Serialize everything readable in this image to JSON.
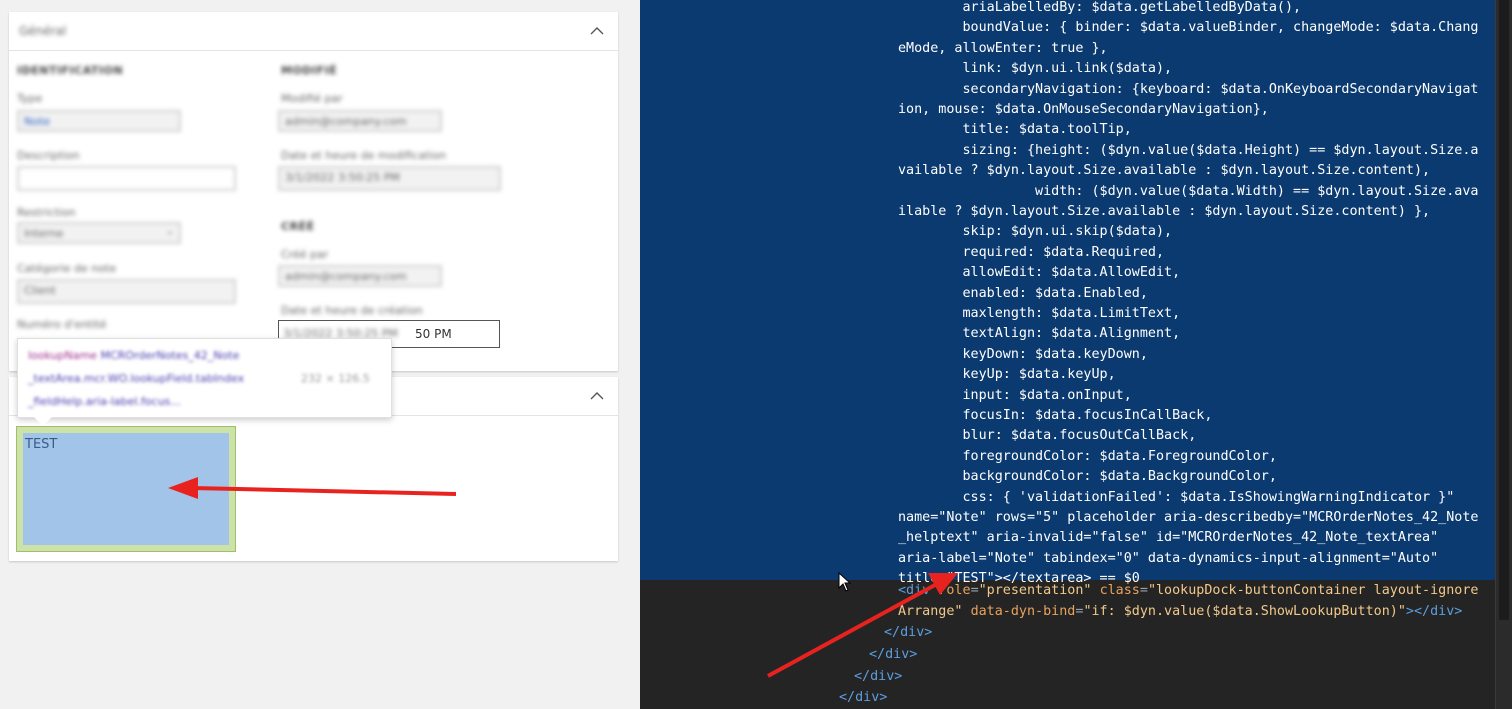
{
  "panel_general": {
    "title": "Général",
    "sections": {
      "identification": "IDENTIFICATION",
      "modified": "MODIFIÉ",
      "created": "CRÉÉ"
    },
    "fields": {
      "type_label": "Type",
      "type_value": "Note",
      "description_label": "Description",
      "restriction_label": "Restriction",
      "restriction_value": "Interne",
      "category_label": "Catégorie de note",
      "category_value": "Client",
      "entity_label": "Numéro d'entité",
      "modified_by_label": "Modifié par",
      "modified_by_value": "admin@company.com",
      "modified_date_label": "Date et heure de modification",
      "modified_date_value": "3/1/2022 3:50:25 PM",
      "created_by_label": "Créé par",
      "created_by_value": "admin@company.com",
      "created_date_label": "Date et heure de création",
      "created_date_value": "3/1/2022 3:50:25 PM",
      "time_fragment": "50 PM"
    }
  },
  "tooltip": {
    "line1_prefix": "lookupName",
    "line1_rest": " MCROrderNotes_42_Note",
    "line2": "_textArea.mcr.WO.lookupField.tabIndex",
    "line2_dims": "232 × 126.5",
    "line3": "_fieldHelp.aria-label.focus..."
  },
  "note_panel": {
    "textarea_value": "TEST"
  },
  "devtools": {
    "lines": [
      "        ariaLabelledBy: $data.getLabelledByData(),",
      "        boundValue: { binder: $data.valueBinder, changeMode: $data.Chang",
      "eMode, allowEnter: true },",
      "        link: $dyn.ui.link($data),",
      "        secondaryNavigation: {keyboard: $data.OnKeyboardSecondaryNavigat",
      "ion, mouse: $data.OnMouseSecondaryNavigation},",
      "        title: $data.toolTip,",
      "        sizing: {height: ($dyn.value($data.Height) == $dyn.layout.Size.a",
      "vailable ? $dyn.layout.Size.available : $dyn.layout.Size.content),",
      "                 width: ($dyn.value($data.Width) == $dyn.layout.Size.ava",
      "ilable ? $dyn.layout.Size.available : $dyn.layout.Size.content) },",
      "        skip: $dyn.ui.skip($data),",
      "        required: $data.Required,",
      "        allowEdit: $data.AllowEdit,",
      "        enabled: $data.Enabled,",
      "        maxlength: $data.LimitText,",
      "        textAlign: $data.Alignment,",
      "        keyDown: $data.keyDown,",
      "        keyUp: $data.keyUp,",
      "        input: $data.onInput,",
      "        focusIn: $data.focusInCallBack,",
      "        blur: $data.focusOutCallBack,",
      "        foregroundColor: $data.ForegroundColor,",
      "        backgroundColor: $data.BackgroundColor,",
      "        css: { 'validationFailed': $data.IsShowingWarningIndicator }\"",
      "name=\"Note\" rows=\"5\" placeholder aria-describedby=\"MCROrderNotes_42_Note",
      "_helptext\" aria-invalid=\"false\" id=\"MCROrderNotes_42_Note_textArea\"",
      "aria-label=\"Note\" tabindex=\"0\" data-dynamics-input-alignment=\"Auto\"",
      "title=\"TEST\"></textarea> == $0"
    ],
    "after": {
      "l1_open": "<div ",
      "l1_attr1": "role",
      "l1_val1": "\"presentation\"",
      "l1_attr2": "class",
      "l1_val2": "\"lookupDock-buttonContainer layout-ignore",
      "l2_val2": "Arrange\"",
      "l2_attr3": "data-dyn-bind",
      "l2_val3": "\"if: $dyn.value($data.ShowLookupButton)\"",
      "l2_close": "></div>",
      "close1": "</div>",
      "close2": "</div>",
      "close3": "</div>",
      "close4": "</div>"
    }
  },
  "colors": {
    "devtools_selection": "#0b3a70",
    "devtools_bg": "#242424",
    "arrow": "#e8231f",
    "note_highlight": "#a2c4e8"
  }
}
